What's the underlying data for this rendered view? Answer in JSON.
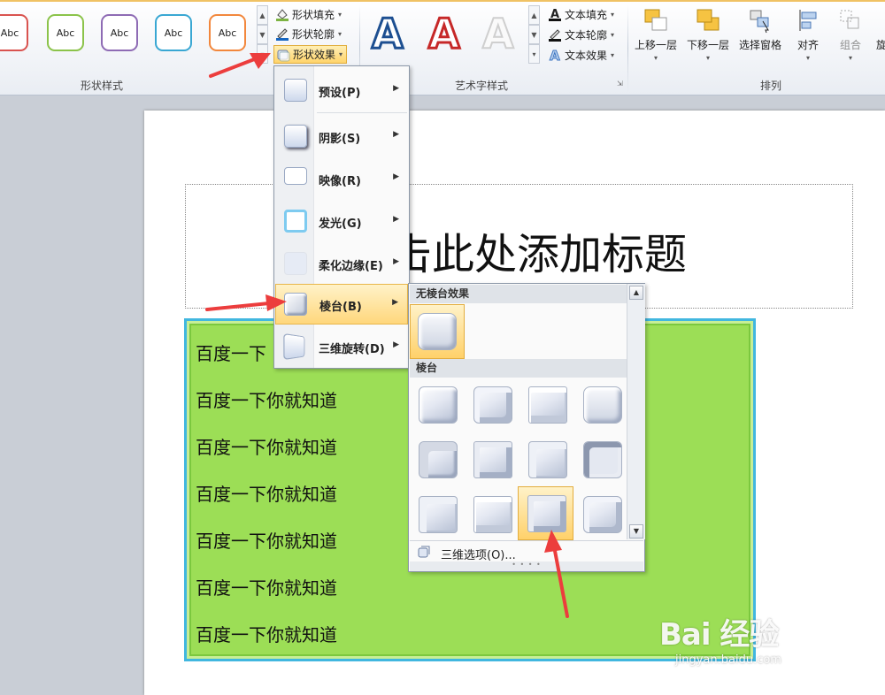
{
  "ribbon": {
    "shape_styles": {
      "group_label": "形状样式",
      "thumbs": [
        {
          "label": "Abc",
          "color": "#d9534f"
        },
        {
          "label": "Abc",
          "color": "#8bc34a"
        },
        {
          "label": "Abc",
          "color": "#8e6bb4"
        },
        {
          "label": "Abc",
          "color": "#39a7d3"
        },
        {
          "label": "Abc",
          "color": "#f2873c"
        }
      ],
      "shape_fill": "形状填充",
      "shape_outline": "形状轮廓",
      "shape_effects": "形状效果"
    },
    "wordart": {
      "group_label": "艺术字样式",
      "letters": [
        "A",
        "A",
        "A"
      ],
      "text_fill": "文本填充",
      "text_outline": "文本轮廓",
      "text_effects": "文本效果"
    },
    "arrange": {
      "group_label": "排列",
      "bring_forward": "上移一层",
      "send_backward": "下移一层",
      "selection_pane": "选择窗格",
      "align": "对齐",
      "group": "组合",
      "rotate": "旋"
    }
  },
  "slide": {
    "title": "击此处添加标题",
    "lines": [
      "百度一下",
      "百度一下你就知道",
      "百度一下你就知道",
      "百度一下你就知道",
      "百度一下你就知道",
      "百度一下你就知道",
      "百度一下你就知道"
    ]
  },
  "effects_menu": {
    "items": [
      {
        "label": "预设(P)"
      },
      {
        "label": "阴影(S)"
      },
      {
        "label": "映像(R)"
      },
      {
        "label": "发光(G)"
      },
      {
        "label": "柔化边缘(E)"
      },
      {
        "label": "棱台(B)"
      },
      {
        "label": "三维旋转(D)"
      }
    ]
  },
  "bevel_panel": {
    "no_bevel_header": "无棱台效果",
    "bevel_header": "棱台",
    "three_d_options": "三维选项(O)..."
  },
  "watermark": {
    "brand": "Bai 经验",
    "url": "jingyan.baidu.com"
  }
}
